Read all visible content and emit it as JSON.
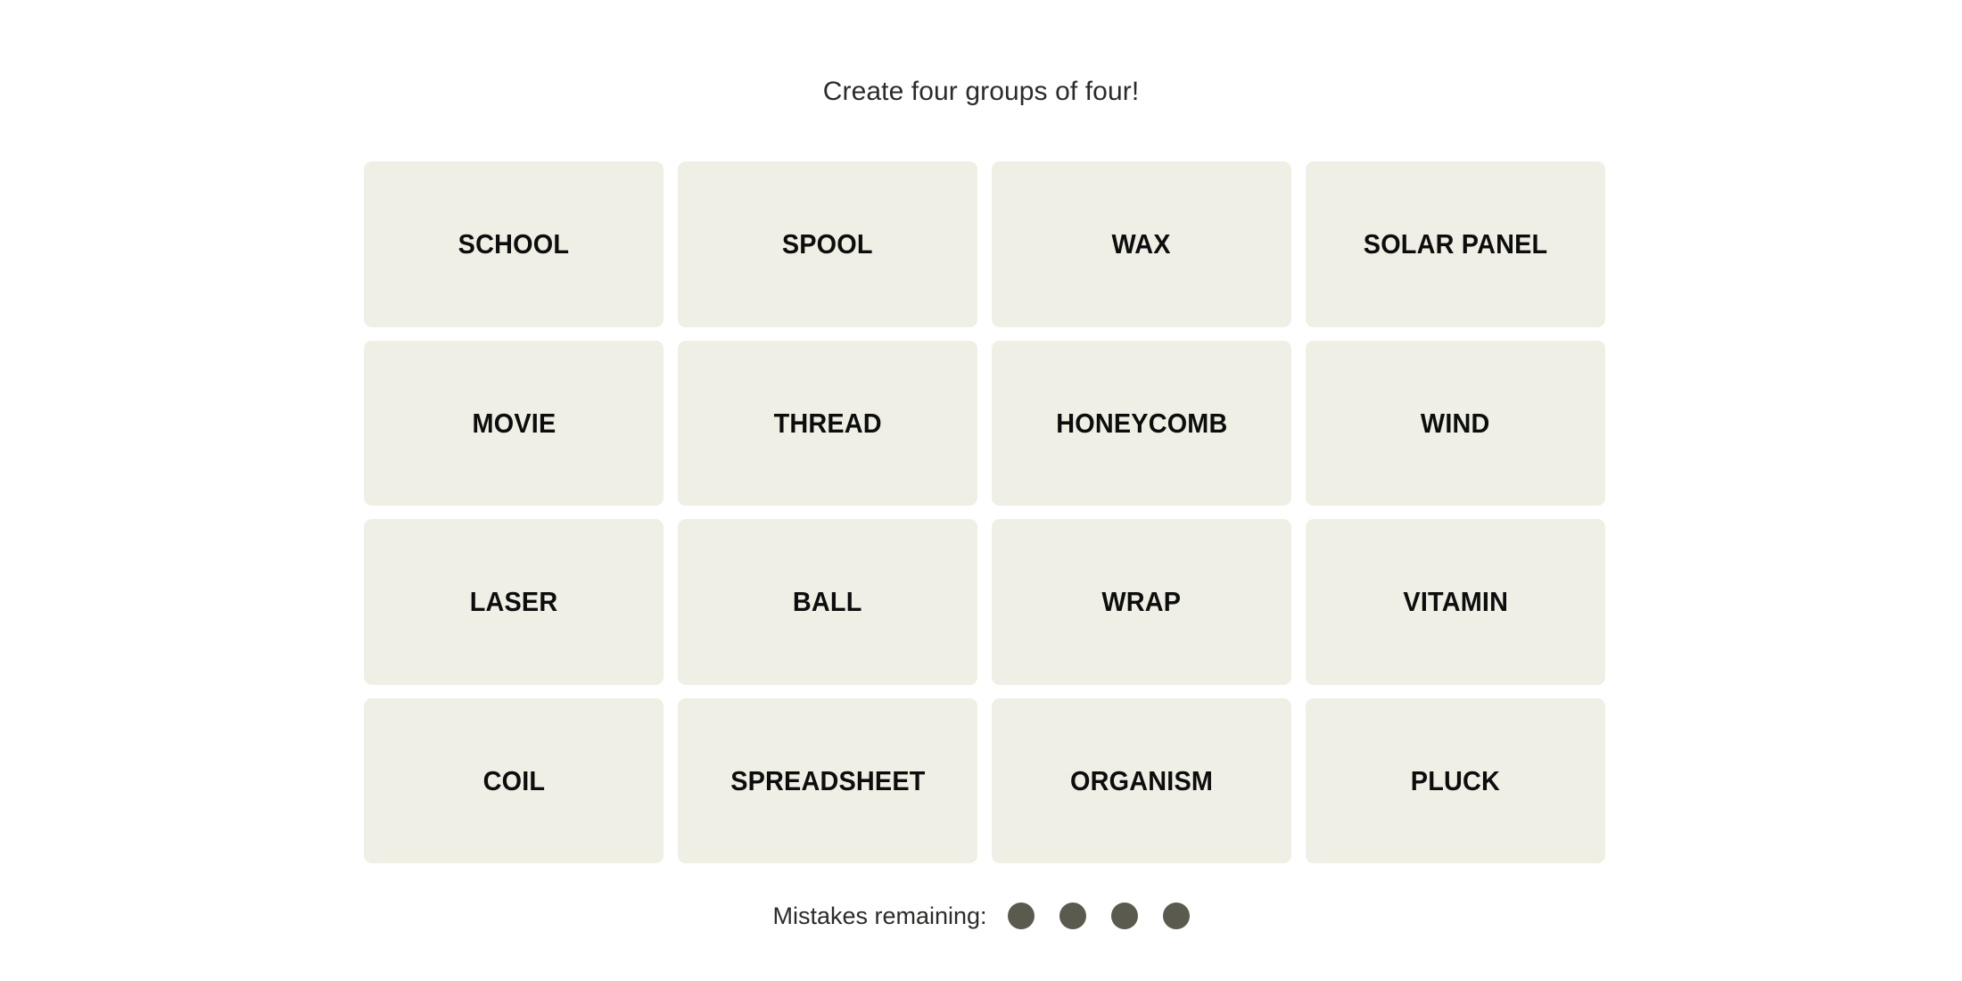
{
  "page": {
    "background_color": "#ffffff"
  },
  "header": {
    "instruction": "Create four groups of four!",
    "text_color": "#2b2b29"
  },
  "board": {
    "rows": 4,
    "columns": 4,
    "tile_color": "#efefe6",
    "tile_text_color": "#0d0d0d",
    "tiles": [
      {
        "label": "SCHOOL"
      },
      {
        "label": "SPOOL"
      },
      {
        "label": "WAX"
      },
      {
        "label": "SOLAR PANEL"
      },
      {
        "label": "MOVIE"
      },
      {
        "label": "THREAD"
      },
      {
        "label": "HONEYCOMB"
      },
      {
        "label": "WIND"
      },
      {
        "label": "LASER"
      },
      {
        "label": "BALL"
      },
      {
        "label": "WRAP"
      },
      {
        "label": "VITAMIN"
      },
      {
        "label": "COIL"
      },
      {
        "label": "SPREADSHEET"
      },
      {
        "label": "ORGANISM"
      },
      {
        "label": "PLUCK"
      }
    ]
  },
  "mistakes": {
    "label": "Mistakes remaining:",
    "remaining": 4,
    "dot_color": "#5a5a4e",
    "dots": [
      {
        "name": "mistake-dot-1"
      },
      {
        "name": "mistake-dot-2"
      },
      {
        "name": "mistake-dot-3"
      },
      {
        "name": "mistake-dot-4"
      }
    ]
  }
}
